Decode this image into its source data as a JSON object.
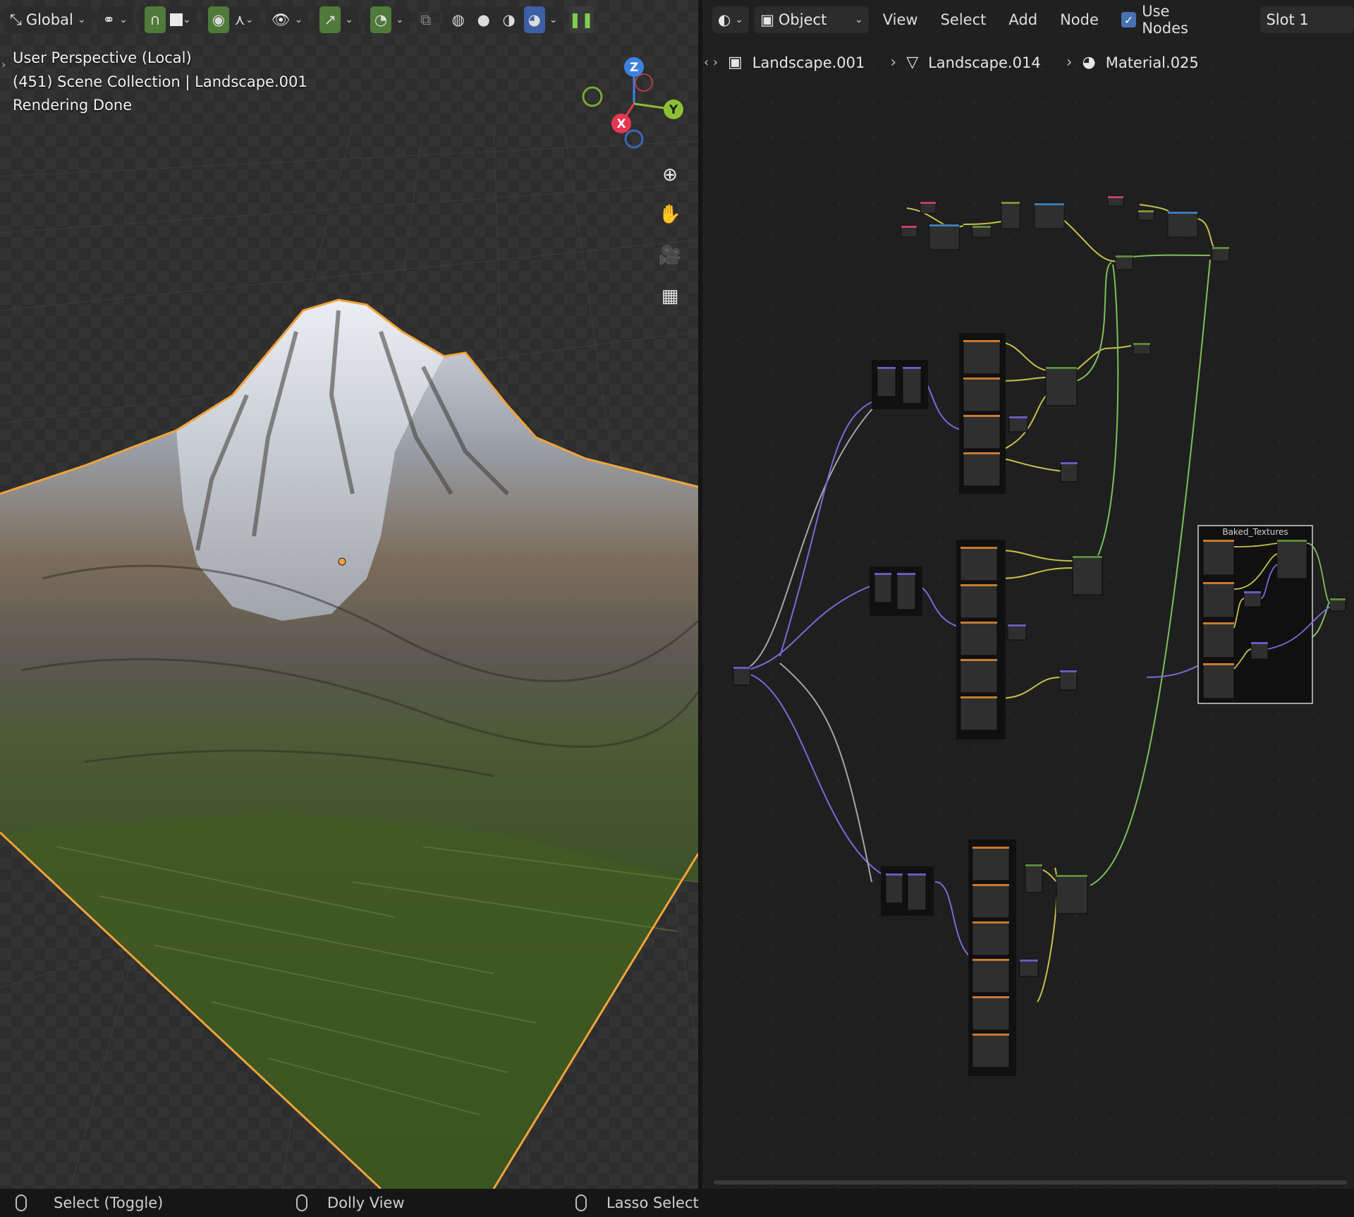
{
  "viewport": {
    "header": {
      "transform_orientation": "Global",
      "toggle_icon": "pause-icon"
    },
    "overlay": {
      "line1": "User Perspective (Local)",
      "line2": "(451) Scene Collection | Landscape.001",
      "line3": "Rendering Done"
    },
    "gizmo": {
      "x": "X",
      "y": "Y",
      "z": "Z",
      "colors": {
        "x": "#e8364f",
        "y": "#8bc034",
        "z": "#3b82e0"
      }
    },
    "nav_icons": [
      "zoom-icon",
      "pan-hand-icon",
      "camera-icon",
      "ortho-grid-icon"
    ]
  },
  "node_editor": {
    "header": {
      "mode": "Object",
      "menus": [
        "View",
        "Select",
        "Add",
        "Node"
      ],
      "use_nodes_label": "Use Nodes",
      "use_nodes_checked": true,
      "slot": "Slot 1"
    },
    "breadcrumb": {
      "object": "Landscape.001",
      "mesh": "Landscape.014",
      "material": "Material.025"
    },
    "frame_label": "Baked_Textures"
  },
  "status_bar": {
    "left": "Select (Toggle)",
    "middle": "Dolly View",
    "right": "Lasso Select"
  },
  "colors": {
    "selection_outline": "#f2a33a",
    "link_yellow": "#c8c04a",
    "link_green": "#7cbf5a",
    "link_purple": "#7a6ad8",
    "link_gray": "#a6a6a6",
    "accent_blue": "#4772b3"
  }
}
